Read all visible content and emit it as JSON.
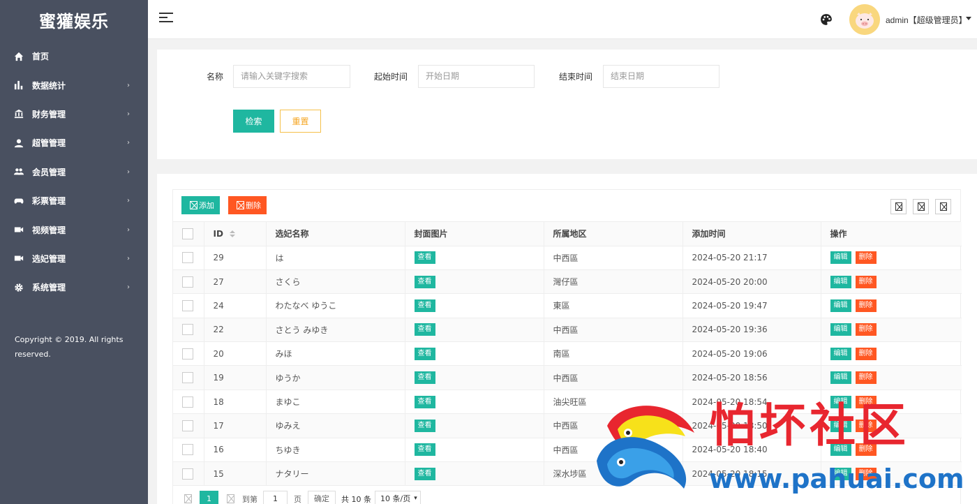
{
  "brand": "蜜獾娱乐",
  "sidebar": {
    "items": [
      {
        "label": "首页",
        "has_arrow": false
      },
      {
        "label": "数据统计",
        "has_arrow": true
      },
      {
        "label": "财务管理",
        "has_arrow": true
      },
      {
        "label": "超管管理",
        "has_arrow": true
      },
      {
        "label": "会员管理",
        "has_arrow": true
      },
      {
        "label": "彩票管理",
        "has_arrow": true
      },
      {
        "label": "视频管理",
        "has_arrow": true
      },
      {
        "label": "选妃管理",
        "has_arrow": true
      },
      {
        "label": "系统管理",
        "has_arrow": true
      }
    ],
    "copyright": "Copyright © 2019. All rights reserved."
  },
  "header": {
    "user": "admin【超级管理员】"
  },
  "search": {
    "name_label": "名称",
    "name_placeholder": "请输入关键字搜索",
    "start_label": "起始时间",
    "start_placeholder": "开始日期",
    "end_label": "结束时间",
    "end_placeholder": "结束日期",
    "search_btn": "检索",
    "reset_btn": "重置"
  },
  "toolbar": {
    "add_label": "添加",
    "delete_label": "删除"
  },
  "table": {
    "columns": [
      "ID",
      "选妃名称",
      "封面图片",
      "所属地区",
      "添加时间",
      "操作"
    ],
    "view_label": "查看",
    "edit_label": "编辑",
    "del_label": "删除",
    "rows": [
      {
        "id": "29",
        "name": "は",
        "region": "中西區",
        "time": "2024-05-20 21:17"
      },
      {
        "id": "27",
        "name": "さくら",
        "region": "灣仔區",
        "time": "2024-05-20 20:00"
      },
      {
        "id": "24",
        "name": "わたなべ ゆうこ",
        "region": "東區",
        "time": "2024-05-20 19:47"
      },
      {
        "id": "22",
        "name": "さとう みゆき",
        "region": "中西區",
        "time": "2024-05-20 19:36"
      },
      {
        "id": "20",
        "name": "みほ",
        "region": "南區",
        "time": "2024-05-20 19:06"
      },
      {
        "id": "19",
        "name": "ゆうか",
        "region": "中西區",
        "time": "2024-05-20 18:56"
      },
      {
        "id": "18",
        "name": "まゆこ",
        "region": "油尖旺區",
        "time": "2024-05-20 18:54"
      },
      {
        "id": "17",
        "name": "ゆみえ",
        "region": "中西區",
        "time": "2024-05-20 18:50"
      },
      {
        "id": "16",
        "name": "ちゆき",
        "region": "中西區",
        "time": "2024-05-20 18:40"
      },
      {
        "id": "15",
        "name": "ナタリー",
        "region": "深水埗區",
        "time": "2024-05-20 18:15"
      }
    ]
  },
  "pagination": {
    "current": "1",
    "goto_label": "到第",
    "page_input": "1",
    "page_unit": "页",
    "confirm": "确定",
    "total": "共 10 条",
    "page_size": "10 条/页"
  },
  "watermark": {
    "title": "怕坏社区",
    "url": "www.pahuai.com"
  },
  "colors": {
    "sidebar_bg": "#495060",
    "accent": "#1fb7a0",
    "danger": "#ff5722",
    "warning": "#f5a623"
  }
}
